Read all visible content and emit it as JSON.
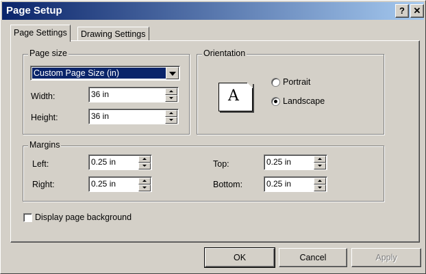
{
  "window": {
    "title": "Page Setup"
  },
  "titlebar_buttons": {
    "help": "?",
    "close": "✕"
  },
  "tabs": [
    {
      "label": "Page Settings",
      "active": true
    },
    {
      "label": "Drawing Settings",
      "active": false
    }
  ],
  "page_size": {
    "legend": "Page size",
    "selected": "Custom Page Size (in)",
    "width_label": "Width:",
    "width_value": "36 in",
    "height_label": "Height:",
    "height_value": "36 in"
  },
  "orientation": {
    "legend": "Orientation",
    "preview_letter": "A",
    "portrait_label": "Portrait",
    "landscape_label": "Landscape",
    "selected": "Landscape"
  },
  "margins": {
    "legend": "Margins",
    "left_label": "Left:",
    "left_value": "0.25 in",
    "right_label": "Right:",
    "right_value": "0.25 in",
    "top_label": "Top:",
    "top_value": "0.25 in",
    "bottom_label": "Bottom:",
    "bottom_value": "0.25 in"
  },
  "display_background": {
    "label": "Display page background",
    "checked": false
  },
  "buttons": {
    "ok": "OK",
    "cancel": "Cancel",
    "apply": "Apply"
  },
  "colors": {
    "titlebar_start": "#0a246a",
    "titlebar_end": "#a6caf0",
    "face": "#d4d0c8",
    "selection": "#0a246a"
  }
}
